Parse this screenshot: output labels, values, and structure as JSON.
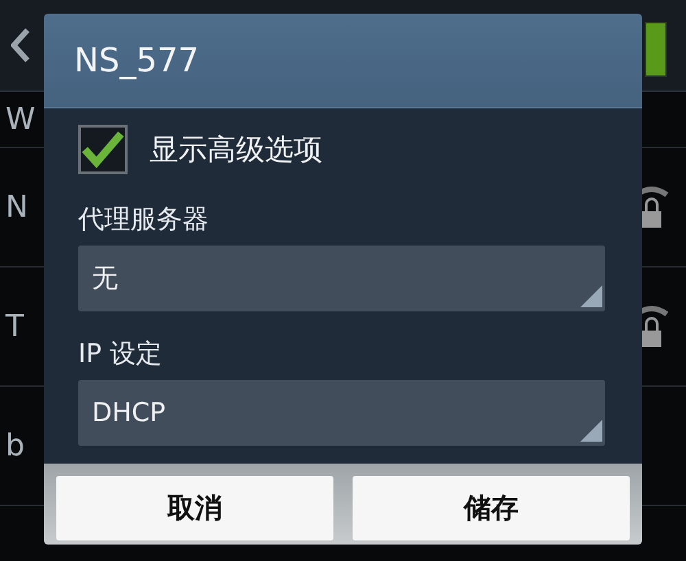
{
  "background": {
    "list_items": [
      {
        "text": "W"
      },
      {
        "text": "N",
        "locked": true
      },
      {
        "text": "T",
        "locked": true
      },
      {
        "text": "b",
        "locked": false
      }
    ],
    "toggle_on": true
  },
  "dialog": {
    "title": "NS_577",
    "advanced": {
      "label": "显示高级选项",
      "checked": true
    },
    "fields": [
      {
        "label": "代理服务器",
        "value": "无"
      },
      {
        "label": "IP 设定",
        "value": "DHCP"
      }
    ],
    "buttons": [
      "取消",
      "储存"
    ]
  }
}
